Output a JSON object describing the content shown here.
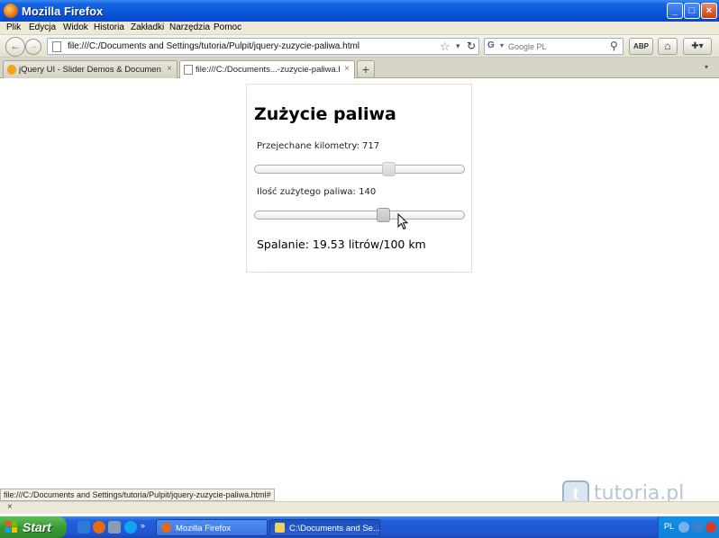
{
  "window": {
    "title": "Mozilla Firefox",
    "controls": {
      "minimize": "_",
      "maximize": "□",
      "close": "×"
    }
  },
  "menu": [
    "Plik",
    "Edycja",
    "Widok",
    "Historia",
    "Zakładki",
    "Narzędzia",
    "Pomoc"
  ],
  "nav": {
    "url": "file:///C:/Documents and Settings/tutoria/Pulpit/jquery-zuzycie-paliwa.html",
    "search_placeholder": "Google PL",
    "addon_button": "ABP",
    "icons": [
      "back-icon",
      "forward-icon",
      "star-icon",
      "reload-icon",
      "search-icon",
      "home-icon",
      "puzzle-icon"
    ]
  },
  "tabs": [
    {
      "label": "jQuery UI - Slider Demos & Documentation",
      "close": "×",
      "active": false
    },
    {
      "label": "file:///C:/Documents...-zuzycie-paliwa.html",
      "close": "×",
      "active": true
    }
  ],
  "new_tab": "+",
  "page": {
    "heading": "Zużycie paliwa",
    "km_label": "Przejechane kilometry: 717",
    "km_value": 717,
    "km_slider_fraction": 0.64,
    "fuel_label": "Ilość zużytego paliwa: 140",
    "fuel_value": 140,
    "fuel_slider_fraction": 0.61,
    "result": "Spalanie: 19.53 litrów/100 km"
  },
  "status_url": "file:///C:/Documents and Settings/tutoria/Pulpit/jquery-zuzycie-paliwa.html#",
  "findbar_close": "×",
  "watermark": {
    "icon_letter": "t",
    "text": "tutoria.pl"
  },
  "taskbar": {
    "start": "Start",
    "tasks": [
      {
        "label": "Mozilla Firefox",
        "active": false
      },
      {
        "label": "C:\\Documents and Se...",
        "active": true
      }
    ],
    "language": "PL"
  },
  "colors": {
    "xp_blue": "#0a55d8",
    "start_green": "#3a9a36",
    "slider_handle": "#d6d6d6"
  }
}
